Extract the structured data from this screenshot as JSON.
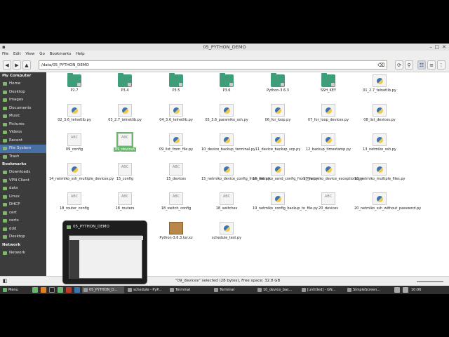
{
  "window": {
    "title": "05_PYTHON_DEMO"
  },
  "menu": [
    "File",
    "Edit",
    "View",
    "Go",
    "Bookmarks",
    "Help"
  ],
  "path": "/data/05_PYTHON_DEMO",
  "sidebar": {
    "my_computer": "My Computer",
    "computer_items": [
      "Home",
      "Desktop",
      "Images",
      "Documents",
      "Music",
      "Pictures",
      "Videos",
      "Recent",
      "File System",
      "Trash"
    ],
    "bookmarks": "Bookmarks",
    "bookmark_items": [
      "Downloads",
      "VPN Client",
      "data",
      "Linux",
      "DHCP",
      "cert",
      "certs",
      "ddd",
      "Desktop"
    ],
    "network": "Network",
    "network_items": [
      "Network"
    ]
  },
  "files": [
    {
      "name": "P2.7",
      "type": "folder"
    },
    {
      "name": "P3.4",
      "type": "folder"
    },
    {
      "name": "P3.5",
      "type": "folder"
    },
    {
      "name": "P3.6",
      "type": "folder"
    },
    {
      "name": "Python-3.6.3",
      "type": "folder"
    },
    {
      "name": "SSH_KEY",
      "type": "folder"
    },
    {
      "name": "01_2.7_telnetlib.py",
      "type": "py"
    },
    {
      "name": "02_3.6_telnetlib.py",
      "type": "py"
    },
    {
      "name": "03_2.7_telnetlib.py",
      "type": "py"
    },
    {
      "name": "04_3.6_telnetlib.py",
      "type": "py"
    },
    {
      "name": "05_3.6_paramiko_ssh.py",
      "type": "py"
    },
    {
      "name": "06_for_loop.py",
      "type": "py"
    },
    {
      "name": "07_for_loop_devices.py",
      "type": "py"
    },
    {
      "name": "08_list_devices.py",
      "type": "py"
    },
    {
      "name": "09_config",
      "type": "txt"
    },
    {
      "name": "09_devices",
      "type": "txt",
      "selected": true
    },
    {
      "name": "09_list_from_file.py",
      "type": "py"
    },
    {
      "name": "10_device_backup_terminal.py",
      "type": "py"
    },
    {
      "name": "11_device_backup_scp.py",
      "type": "py"
    },
    {
      "name": "12_backup_timestamp.py",
      "type": "py"
    },
    {
      "name": "13_netmiko_ssh.py",
      "type": "py"
    },
    {
      "name": "14_netmiko_ssh_multiple_devices.py",
      "type": "py"
    },
    {
      "name": "15_config",
      "type": "txt"
    },
    {
      "name": "15_devices",
      "type": "txt"
    },
    {
      "name": "15_netmiko_device_config_from_file.py",
      "type": "py"
    },
    {
      "name": "16_netmiko_send_config_from_file.py",
      "type": "py"
    },
    {
      "name": "17_netmiko_device_exceptions.py",
      "type": "py"
    },
    {
      "name": "18_netmiko_multiple_files.py",
      "type": "py"
    },
    {
      "name": "18_router_config",
      "type": "txt"
    },
    {
      "name": "18_routers",
      "type": "txt"
    },
    {
      "name": "18_switch_config",
      "type": "txt"
    },
    {
      "name": "18_switches",
      "type": "txt"
    },
    {
      "name": "19_netmiko_config_backup_to_file.py",
      "type": "py"
    },
    {
      "name": "20_devices",
      "type": "txt"
    },
    {
      "name": "20_netmiko_ssh_without_password.py",
      "type": "py"
    },
    {
      "name": "21_",
      "type": "py"
    },
    {
      "name": "Python-3.6.3.tar.xz",
      "type": "archive"
    },
    {
      "name": "schedule_test.py",
      "type": "py"
    }
  ],
  "txt_label": "ABC",
  "status": "\"09_devices\" selected (28 bytes), Free space: 32.8 GB",
  "preview_title": "05_PYTHON_DEMO",
  "taskbar": {
    "menu": "Menu",
    "items": [
      "05_PYTHON_D...",
      "schedule - PyP...",
      "Terminal",
      "Terminal",
      "10_device_bac...",
      "[untitled] - GN...",
      "SimpleScreen..."
    ],
    "clock": "10:06"
  }
}
